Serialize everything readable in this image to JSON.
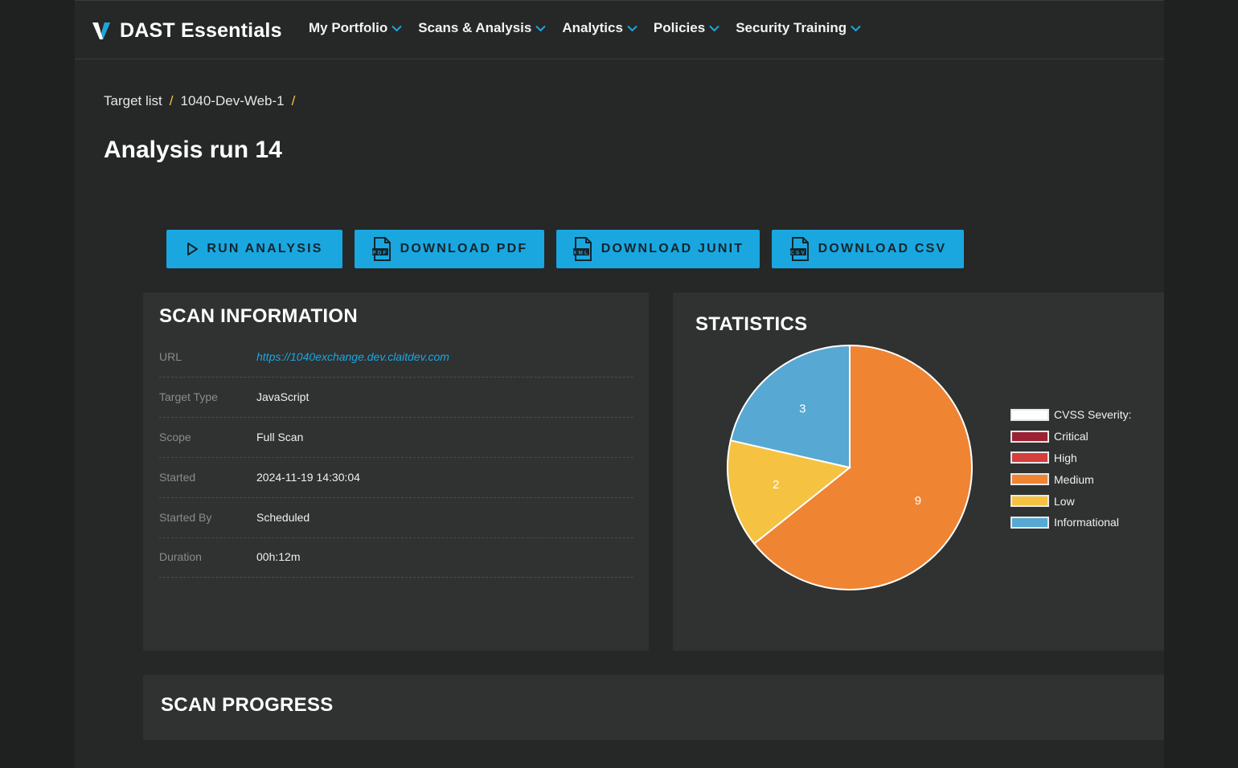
{
  "app": {
    "name": "DAST Essentials",
    "brand_color": "#1aa7e0",
    "nav": [
      {
        "label": "My Portfolio",
        "icon": "chevron-down-icon"
      },
      {
        "label": "Scans & Analysis",
        "icon": "chevron-down-icon"
      },
      {
        "label": "Analytics",
        "icon": "chevron-down-icon"
      },
      {
        "label": "Policies",
        "icon": "chevron-down-icon"
      },
      {
        "label": "Security Training",
        "icon": "chevron-down-icon"
      }
    ]
  },
  "breadcrumb": {
    "items": [
      "Target list",
      "1040-Dev-Web-1"
    ],
    "separator": "/"
  },
  "page": {
    "title": "Analysis run 14"
  },
  "actions": {
    "run_analysis": {
      "label": "RUN ANALYSIS",
      "icon": "play-icon"
    },
    "download_pdf": {
      "label": "DOWNLOAD PDF",
      "icon": "pdf-file-icon"
    },
    "download_junit": {
      "label": "DOWNLOAD JUNIT",
      "icon": "xml-file-icon"
    },
    "download_csv": {
      "label": "DOWNLOAD CSV",
      "icon": "csv-file-icon"
    }
  },
  "scan_info": {
    "title": "SCAN INFORMATION",
    "rows": [
      {
        "label": "URL",
        "value": "https://1040exchange.dev.claitdev.com"
      },
      {
        "label": "Target Type",
        "value": "JavaScript"
      },
      {
        "label": "Scope",
        "value": "Full Scan"
      },
      {
        "label": "Started",
        "value": "2024-11-19 14:30:04"
      },
      {
        "label": "Started By",
        "value": "Scheduled"
      },
      {
        "label": "Duration",
        "value": "00h:12m"
      }
    ]
  },
  "statistics": {
    "title": "STATISTICS",
    "chart_data": {
      "type": "pie",
      "slices": [
        {
          "name": "Medium",
          "value": 9,
          "color": "#ef8433"
        },
        {
          "name": "Low",
          "value": 2,
          "color": "#f5c242"
        },
        {
          "name": "Informational",
          "value": 3,
          "color": "#57a8d2"
        }
      ],
      "legend": {
        "placement": "right",
        "entries": [
          {
            "label": "CVSS Severity:",
            "color": "#ffffff"
          },
          {
            "label": "Critical",
            "color": "#9b2232"
          },
          {
            "label": "High",
            "color": "#d43e3e"
          },
          {
            "label": "Medium",
            "color": "#ef8433"
          },
          {
            "label": "Low",
            "color": "#f5c242"
          },
          {
            "label": "Informational",
            "color": "#57a8d2"
          }
        ]
      }
    }
  },
  "scan_progress": {
    "title": "SCAN PROGRESS"
  }
}
